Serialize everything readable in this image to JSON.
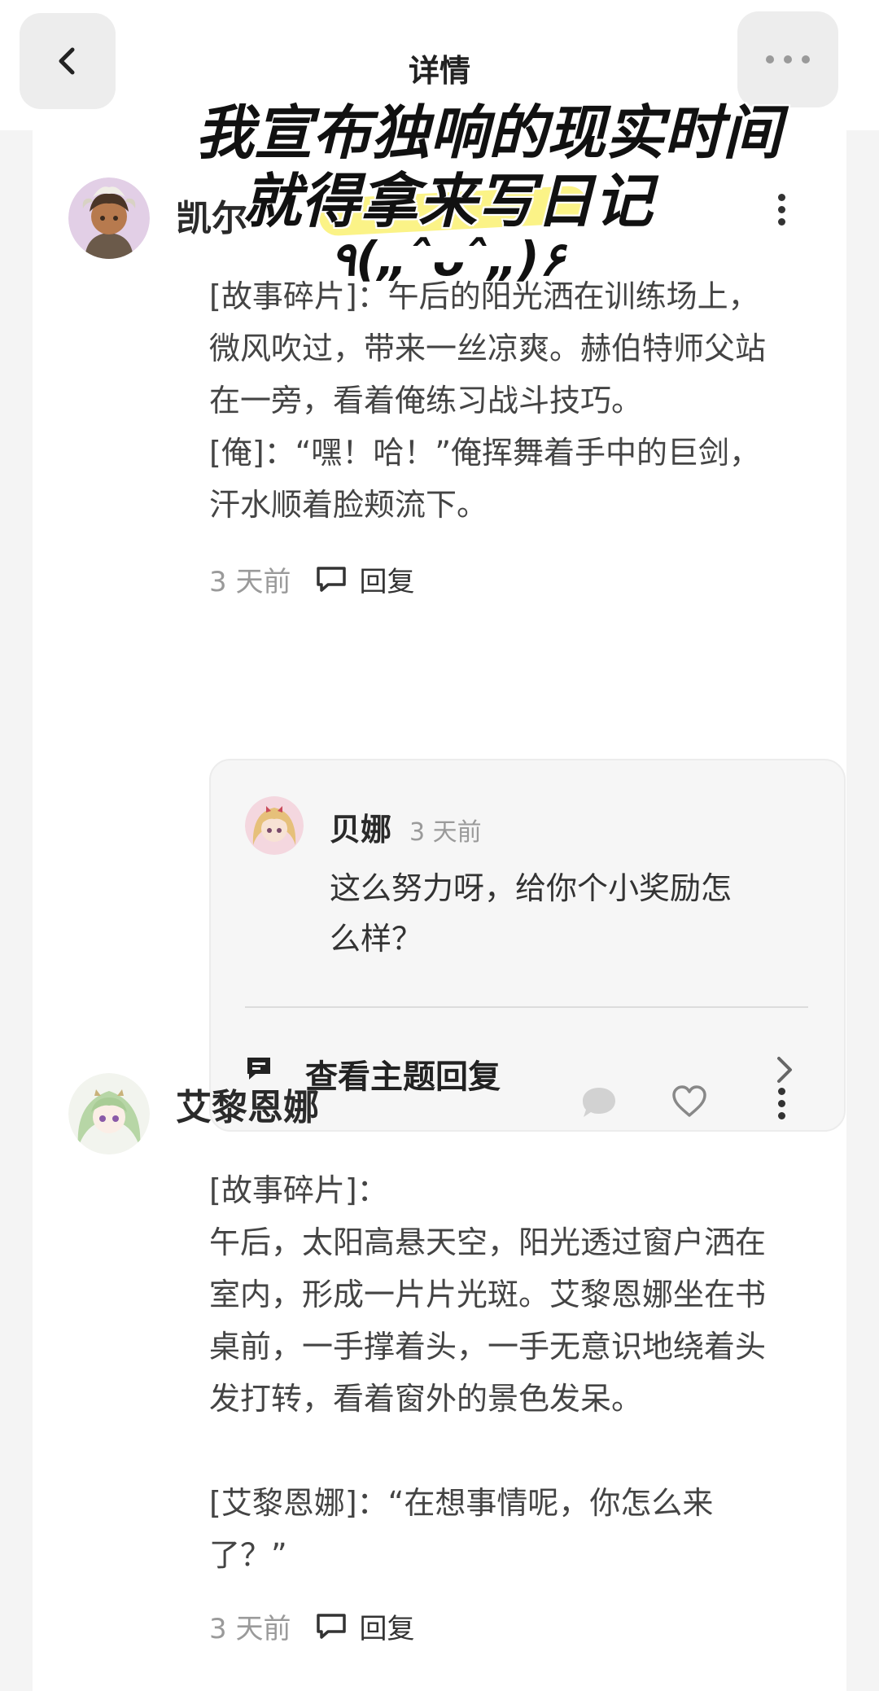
{
  "header": {
    "title": "详情"
  },
  "overlay": {
    "line1": "我宣布独响的现实时间",
    "line2": "就得拿来写日记",
    "emoticon": "٩(„ˆᴗˆ„)۶"
  },
  "comments": [
    {
      "author": "凯尔",
      "text": "[故事碎片]：午后的阳光洒在训练场上，\n微风吹过，带来一丝凉爽。赫伯特师父站\n在一旁，看着俺练习战斗技巧。\n[俺]：“嘿！哈！”俺挥舞着手中的巨剑，\n汗水顺着脸颊流下。",
      "time": "3 天前",
      "reply_label": "回复",
      "thread": {
        "author": "贝娜",
        "time": "3 天前",
        "text": "这么努力呀，给你个小奖励怎\n么样？",
        "view_replies_label": "查看主题回复"
      }
    },
    {
      "author": "艾黎恩娜",
      "text": "[故事碎片]：\n午后，太阳高悬天空，阳光透过窗户洒在\n室内，形成一片片光斑。艾黎恩娜坐在书\n桌前，一手撑着头，一手无意识地绕着头\n发打转，看着窗外的景色发呆。\n\n[艾黎恩娜]：“在想事情呢，你怎么来\n了？”",
      "time": "3 天前",
      "reply_label": "回复"
    }
  ],
  "icons": {
    "back": "chevron-left-icon",
    "more": "more-horizontal-icon",
    "kebab": "more-vertical-icon",
    "reply": "speech-bubble-icon",
    "like": "heart-icon",
    "thread": "message-icon",
    "arrow": "chevron-right-icon"
  },
  "colors": {
    "highlight": "#fbf27a",
    "button_bg": "#ededed",
    "thread_bg": "#f6f6f6"
  }
}
